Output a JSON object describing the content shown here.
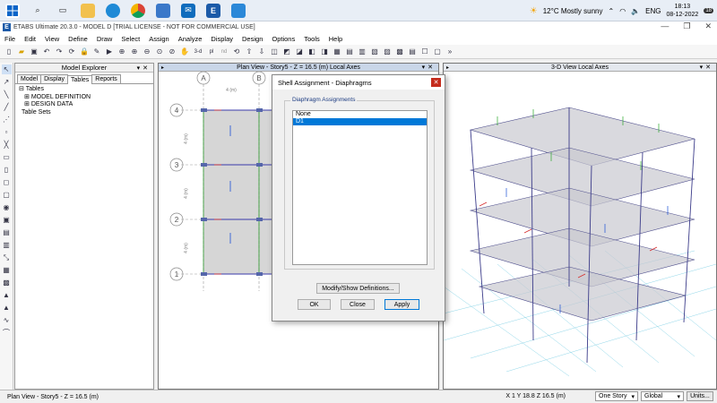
{
  "taskbar": {
    "weather": "12°C  Mostly sunny",
    "language": "ENG",
    "time": "18:13",
    "date": "08-12-2022",
    "notifications": "18"
  },
  "window": {
    "title": "ETABS Ultimate 20.3.0 - MODEL D  [TRIAL LICENSE - NOT FOR COMMERCIAL USE]"
  },
  "menu": [
    "File",
    "Edit",
    "View",
    "Define",
    "Draw",
    "Select",
    "Assign",
    "Analyze",
    "Display",
    "Design",
    "Options",
    "Tools",
    "Help"
  ],
  "toolbar": {
    "btn_3d": "3-d",
    "btn_pl": "pl",
    "btn_nd": "nd"
  },
  "explorer": {
    "title": "Model Explorer",
    "tabs": [
      "Model",
      "Display",
      "Tables",
      "Reports"
    ],
    "tree": {
      "root": "Tables",
      "children": [
        "MODEL DEFINITION",
        "DESIGN DATA"
      ],
      "sibling": "Table Sets"
    }
  },
  "plan_view": {
    "title": "Plan View - Story5 - Z = 16.5 (m)  Local Axes",
    "grid_columns": [
      "A",
      "B"
    ],
    "grid_rows": [
      "4",
      "3",
      "2",
      "1"
    ],
    "dim_horizontal": "4 (m)",
    "dim_vertical": "4 (m)"
  },
  "view_3d": {
    "title": "3-D View  Local Axes"
  },
  "dialog": {
    "title": "Shell Assignment - Diaphragms",
    "group_label": "Diaphragm Assignments",
    "options": [
      "None",
      "D1"
    ],
    "selected_index": 1,
    "modify_button": "Modify/Show Definitions...",
    "ok_button": "OK",
    "close_button": "Close",
    "apply_button": "Apply"
  },
  "status": {
    "left": "Plan View - Story5 - Z = 16.5 (m)",
    "coords": "X 1  Y 18.8  Z 16.5 (m)",
    "story_select": "One Story",
    "coord_system": "Global",
    "units_button": "Units..."
  }
}
